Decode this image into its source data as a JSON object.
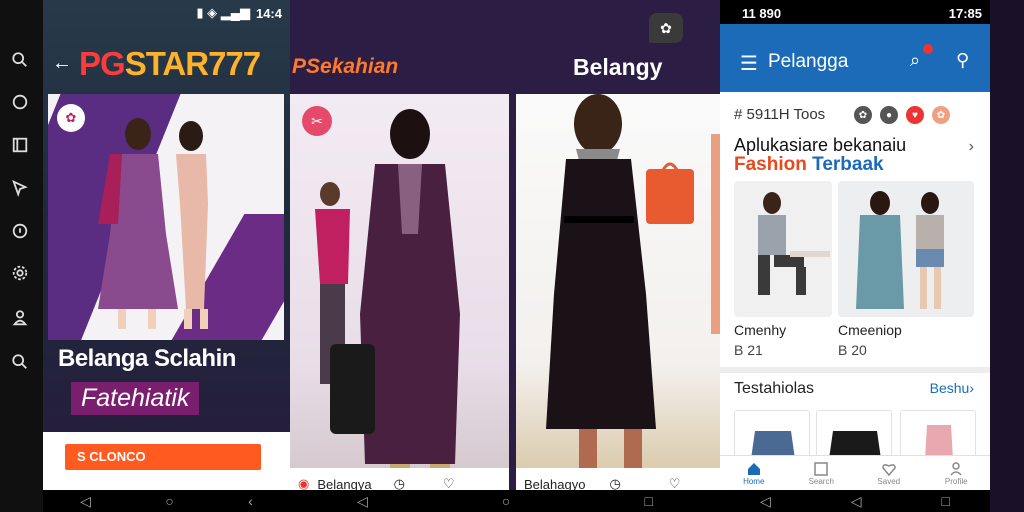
{
  "sidebar": {
    "icons": [
      "search-icon",
      "whatsapp-icon",
      "book-icon",
      "cursor-icon",
      "info-icon",
      "settings-icon",
      "person-icon",
      "search-icon"
    ]
  },
  "screen1": {
    "status": "14:4",
    "brand_part1": "PG",
    "brand_part2": "STAR777",
    "promo_title": "Belanga Sclahin",
    "promo_badge": "Fatehiatik",
    "orange_button": "S CLONCO"
  },
  "screen2": {
    "title_left": "PSekahian",
    "title_right": "Belangy",
    "card1_footer": "Belangya",
    "card2_footer": "Belahagyo"
  },
  "screen3": {
    "status_left": "11 890",
    "status_right": "17:85",
    "app_title": "Pelangga",
    "tags_label": "# 5911H Toos",
    "heading_line1": "Aplukasiare bekanaiu",
    "heading_fashion": "Fashion",
    "heading_terbaak": "Terbaak",
    "product1_name": "Cmenhy",
    "product1_price": "B 21",
    "product2_name": "Cmeeniop",
    "product2_price": "B 20",
    "section_title": "Testahiolas",
    "see_more": "Beshu›",
    "tabs": [
      "Home",
      "Search",
      "Saved",
      "Profile"
    ]
  },
  "colors": {
    "accent_blue": "#1c6bb8",
    "accent_orange": "#ff5a1f",
    "brand_red": "#ff3a3a",
    "brand_yellow": "#ffb22a"
  }
}
